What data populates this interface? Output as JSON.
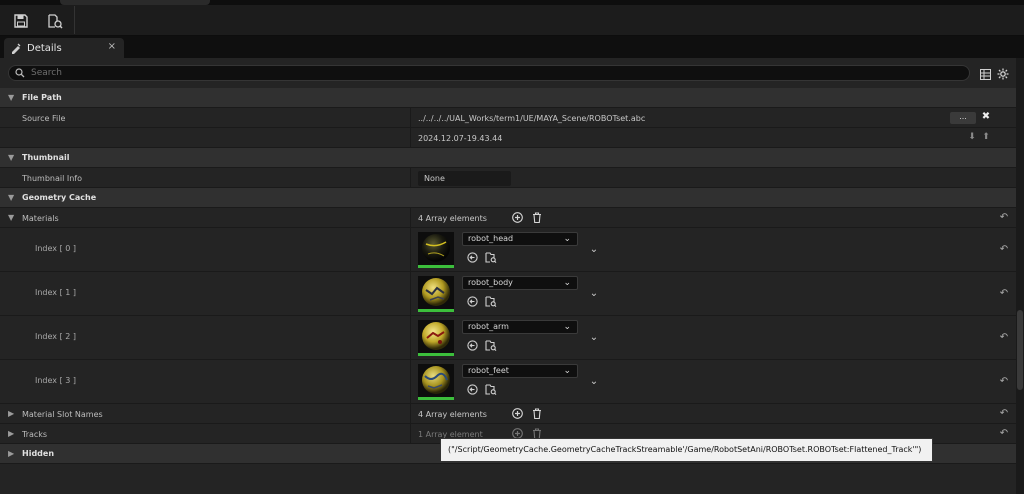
{
  "toolbar": {
    "items": [
      {
        "icon": "save-icon"
      },
      {
        "icon": "browse-to-asset-icon"
      }
    ]
  },
  "tab": {
    "label": "Details",
    "close": "×"
  },
  "search": {
    "placeholder": "Search"
  },
  "sections": {
    "file_path": {
      "title": "File Path",
      "source_file_label": "Source File",
      "source_file_value": "../../../../UAL_Works/term1/UE/MAYA_Scene/ROBOTset.abc",
      "browse_label": "...",
      "timestamp": "2024.12.07-19.43.44"
    },
    "thumbnail": {
      "title": "Thumbnail",
      "info_label": "Thumbnail Info",
      "info_value": "None"
    },
    "geometry_cache": {
      "title": "Geometry Cache",
      "materials_label": "Materials",
      "materials_count": "4 Array elements",
      "materials": [
        {
          "index": "Index [ 0 ]",
          "name": "robot_head"
        },
        {
          "index": "Index [ 1 ]",
          "name": "robot_body"
        },
        {
          "index": "Index [ 2 ]",
          "name": "robot_arm"
        },
        {
          "index": "Index [ 3 ]",
          "name": "robot_feet"
        }
      ],
      "slot_names_label": "Material Slot Names",
      "slot_names_count": "4 Array elements",
      "tracks_label": "Tracks",
      "tracks_count": "1 Array element"
    },
    "hidden": {
      "title": "Hidden"
    }
  },
  "tooltip": "(\"/Script/GeometryCache.GeometryCacheTrackStreamable'/Game/RobotSetAni/ROBOTset.ROBOTset:Flattened_Track'\")",
  "colors": {
    "thumb_border": "#3cbf3c",
    "panel_bg": "#242424",
    "category_bg": "#303030"
  }
}
